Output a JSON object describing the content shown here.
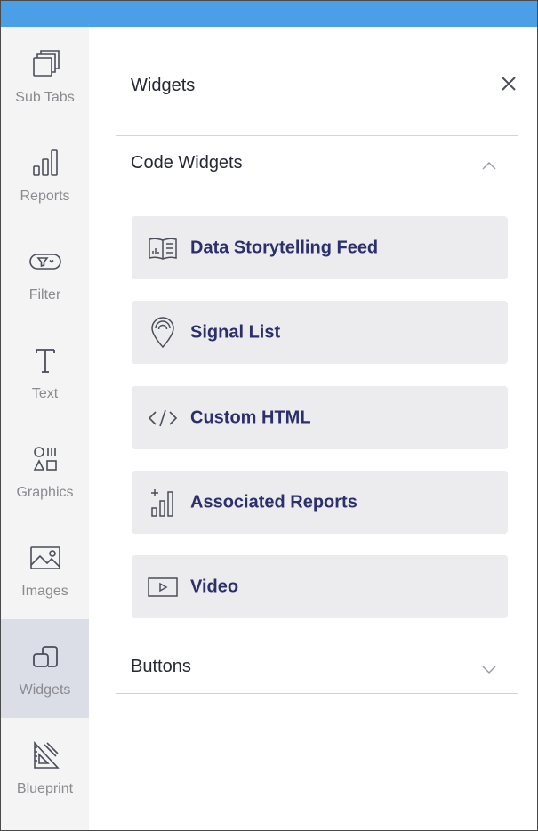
{
  "rail": {
    "items": [
      {
        "label": "Sub Tabs",
        "icon": "sub-tabs-icon",
        "active": false
      },
      {
        "label": "Reports",
        "icon": "reports-icon",
        "active": false
      },
      {
        "label": "Filter",
        "icon": "filter-icon",
        "active": false
      },
      {
        "label": "Text",
        "icon": "text-icon",
        "active": false
      },
      {
        "label": "Graphics",
        "icon": "graphics-icon",
        "active": false
      },
      {
        "label": "Images",
        "icon": "images-icon",
        "active": false
      },
      {
        "label": "Widgets",
        "icon": "widgets-icon",
        "active": true
      },
      {
        "label": "Blueprint",
        "icon": "blueprint-icon",
        "active": false
      }
    ]
  },
  "panel": {
    "title": "Widgets",
    "close_icon": "close-icon"
  },
  "sections": {
    "code_widgets": {
      "title": "Code Widgets",
      "expanded": true,
      "items": [
        {
          "label": "Data Storytelling Feed",
          "icon": "storytelling-feed-icon"
        },
        {
          "label": "Signal List",
          "icon": "signal-pin-icon"
        },
        {
          "label": "Custom HTML",
          "icon": "code-brackets-icon"
        },
        {
          "label": "Associated Reports",
          "icon": "associated-reports-icon"
        },
        {
          "label": "Video",
          "icon": "video-play-icon"
        }
      ]
    },
    "buttons": {
      "title": "Buttons",
      "expanded": false
    }
  },
  "colors": {
    "topbar": "#4a9fe6",
    "rail_bg": "#f4f4f5",
    "rail_active_bg": "#dcdee7",
    "card_bg": "#ececef",
    "card_text": "#2b2f6b",
    "icon_stroke": "#4a4d5a"
  }
}
